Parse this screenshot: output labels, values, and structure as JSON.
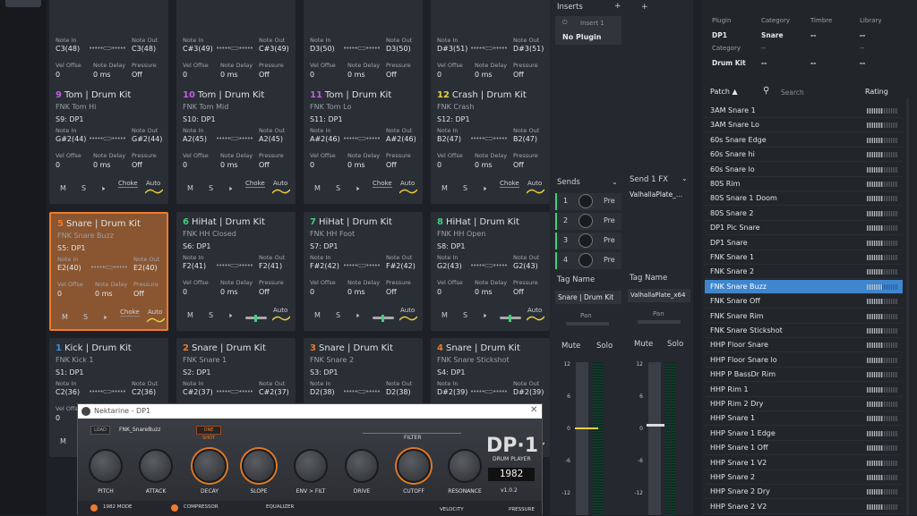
{
  "pads": [
    {
      "num": "",
      "name": "",
      "sub": "",
      "slot": "",
      "note_in": "C3(48)",
      "note_out": "C3(48)",
      "vel": "0",
      "delay": "0 ms",
      "pressure": "Off",
      "slider": "plain"
    },
    {
      "num": "",
      "name": "",
      "sub": "",
      "slot": "",
      "note_in": "C#3(49)",
      "note_out": "C#3(49)",
      "vel": "0",
      "delay": "0 ms",
      "pressure": "Off",
      "slider": "plain"
    },
    {
      "num": "",
      "name": "",
      "sub": "",
      "slot": "",
      "note_in": "D3(50)",
      "note_out": "D3(50)",
      "vel": "0",
      "delay": "0 ms",
      "pressure": "Off",
      "slider": "plain"
    },
    {
      "num": "",
      "name": "",
      "sub": "",
      "slot": "",
      "note_in": "D#3(51)",
      "note_out": "D#3(51)",
      "vel": "0",
      "delay": "0 ms",
      "pressure": "Off",
      "slider": "plain"
    },
    {
      "num": "9",
      "name": "Tom | Drum Kit",
      "sub": "FNK Tom Hi",
      "slot": "S9: DP1",
      "note_in": "G#2(44)",
      "note_out": "G#2(44)",
      "vel": "0",
      "delay": "0 ms",
      "pressure": "Off",
      "slider": "plain"
    },
    {
      "num": "10",
      "name": "Tom | Drum Kit",
      "sub": "FNK Tom Mid",
      "slot": "S10: DP1",
      "note_in": "A2(45)",
      "note_out": "A2(45)",
      "vel": "0",
      "delay": "0 ms",
      "pressure": "Off",
      "slider": "plain"
    },
    {
      "num": "11",
      "name": "Tom | Drum Kit",
      "sub": "FNK Tom Lo",
      "slot": "S11: DP1",
      "note_in": "A#2(46)",
      "note_out": "A#2(46)",
      "vel": "0",
      "delay": "0 ms",
      "pressure": "Off",
      "slider": "plain"
    },
    {
      "num": "12",
      "name": "Crash | Drum Kit",
      "sub": "FNK Crash",
      "slot": "S12: DP1",
      "note_in": "B2(47)",
      "note_out": "B2(47)",
      "vel": "0",
      "delay": "0 ms",
      "pressure": "Off",
      "slider": "plain"
    },
    {
      "num": "5",
      "name": "Snare | Drum Kit",
      "sub": "FNK Snare Buzz",
      "slot": "S5: DP1",
      "note_in": "E2(40)",
      "note_out": "E2(40)",
      "vel": "0",
      "delay": "0 ms",
      "pressure": "Off",
      "slider": "plain",
      "selected": true
    },
    {
      "num": "6",
      "name": "HiHat | Drum Kit",
      "sub": "FNK HH Closed",
      "slot": "S6: DP1",
      "note_in": "F2(41)",
      "note_out": "F2(41)",
      "vel": "0",
      "delay": "0 ms",
      "pressure": "Off",
      "slider": "green"
    },
    {
      "num": "7",
      "name": "HiHat | Drum Kit",
      "sub": "FNK HH Foot",
      "slot": "S7: DP1",
      "note_in": "F#2(42)",
      "note_out": "F#2(42)",
      "vel": "0",
      "delay": "0 ms",
      "pressure": "Off",
      "slider": "green"
    },
    {
      "num": "8",
      "name": "HiHat | Drum Kit",
      "sub": "FNK HH Open",
      "slot": "S8: DP1",
      "note_in": "G2(43)",
      "note_out": "G2(43)",
      "vel": "0",
      "delay": "0 ms",
      "pressure": "Off",
      "slider": "green"
    },
    {
      "num": "1",
      "name": "Kick | Drum Kit",
      "sub": "FNK Kick 1",
      "slot": "S1: DP1",
      "note_in": "C2(36)",
      "note_out": "C2(36)",
      "vel": "0",
      "delay": "0 ms",
      "pressure": "Off",
      "slider": "plain"
    },
    {
      "num": "2",
      "name": "Snare | Drum Kit",
      "sub": "FNK Snare 1",
      "slot": "S2: DP1",
      "note_in": "C#2(37)",
      "note_out": "C#2(37)",
      "vel": "0",
      "delay": "0 ms",
      "pressure": "Off",
      "slider": "plain"
    },
    {
      "num": "3",
      "name": "Snare | Drum Kit",
      "sub": "FNK Snare 2",
      "slot": "S3: DP1",
      "note_in": "D2(38)",
      "note_out": "D2(38)",
      "vel": "0",
      "delay": "0 ms",
      "pressure": "Off",
      "slider": "plain"
    },
    {
      "num": "4",
      "name": "Snare | Drum Kit",
      "sub": "FNK Snare Stickshot",
      "slot": "S4: DP1",
      "note_in": "D#2(39)",
      "note_out": "D#2(39)",
      "vel": "0",
      "delay": "0 ms",
      "pressure": "Off",
      "slider": "plain"
    }
  ],
  "pad_labels": {
    "note_in": "Note In",
    "note_out": "Note Out",
    "vel": "Vel Offse",
    "delay": "Note Delay",
    "pressure": "Pressure",
    "m": "M",
    "s": "S",
    "choke": "Choke",
    "auto": "Auto"
  },
  "num_colors": {
    "1": "#3a8fe0",
    "2": "#ee7a2c",
    "3": "#ee7a2c",
    "4": "#ee7a2c",
    "5": "#ee7a2c",
    "6": "#3dd07a",
    "7": "#3dd07a",
    "8": "#3dd07a",
    "9": "#c060e0",
    "10": "#c060e0",
    "11": "#c060e0",
    "12": "#e8d040"
  },
  "mixer": {
    "inserts_label": "Inserts",
    "insert_slot": "Insert 1",
    "no_plugin": "No Plugin",
    "sends_label": "Sends",
    "send1fx": "Send 1 FX",
    "send_target": "ValhallaPlate_...",
    "sends": [
      {
        "n": "1",
        "p": "Pre"
      },
      {
        "n": "2",
        "p": "Pre"
      },
      {
        "n": "3",
        "p": "Pre"
      },
      {
        "n": "4",
        "p": "Pre"
      }
    ],
    "tag_label": "Tag Name",
    "tag1": "Snare | Drum Kit",
    "tag2": "ValhallaPlate_x64",
    "pan": "Pan",
    "mute": "Mute",
    "solo": "Solo",
    "scale": [
      "12",
      "6",
      "0",
      "-6",
      "-12"
    ]
  },
  "browser": {
    "h_plugin": "Plugin",
    "h_category": "Category",
    "h_timbre": "Timbre",
    "h_library": "Library",
    "v_plugin": "DP1",
    "v_category": "Snare",
    "v_timbre": "--",
    "v_library": "--",
    "h_category2": "Category",
    "v_category2": "--",
    "v_category2b": "--",
    "kit": "Drum Kit",
    "kit_a": "--",
    "kit_b": "--",
    "kit_c": "--",
    "patch_label": "Patch ▲",
    "search_placeholder": "Search",
    "rating_label": "Rating",
    "patches": [
      "3AM Snare 1",
      "3AM Snare Lo",
      "60s Snare Edge",
      "60s Snare hi",
      "60s Snare lo",
      "80S Rim",
      "80S Snare 1 Doom",
      "80S Snare 2",
      "DP1 Pic Snare",
      "DP1 Snare",
      "FNK Snare 1",
      "FNK Snare 2",
      "FNK Snare Buzz",
      "FNK Snare Off",
      "FNK Snare Rim",
      "FNK Snare Stickshot",
      "HHP Floor Snare",
      "HHP Floor Snare lo",
      "HHP P BassDr Rim",
      "HHP Rim 1",
      "HHP Rim 2 Dry",
      "HHP Snare 1",
      "HHP Snare 1 Edge",
      "HHP Snare 1 Off",
      "HHP Snare 1 V2",
      "HHP Snare 2",
      "HHP Snare 2 Dry",
      "HHP Snare 2 V2"
    ],
    "selected_patch": "FNK Snare Buzz"
  },
  "plugin": {
    "window_title": "Nektarine - DP1",
    "load": "LOAD",
    "patch": "FNK_SnareBuzz",
    "one_shot": "ONE SHOT",
    "filter": "FILTER",
    "logo": "DP·1",
    "drum_player": "DRUM PLAYER",
    "counter": "1982",
    "version": "v1.0.2",
    "knobs": [
      "PITCH",
      "ATTACK",
      "DECAY",
      "SLOPE",
      "ENV > FILT",
      "DRIVE",
      "CUTOFF",
      "RESONANCE"
    ],
    "mode": "1982 MODE",
    "compressor": "COMPRESSOR",
    "equalizer": "EQUALIZER",
    "velocity": "VELOCITY",
    "pressure": "PRESSURE"
  },
  "accent": "#ee7a2c",
  "select_blue": "#3f86cf"
}
